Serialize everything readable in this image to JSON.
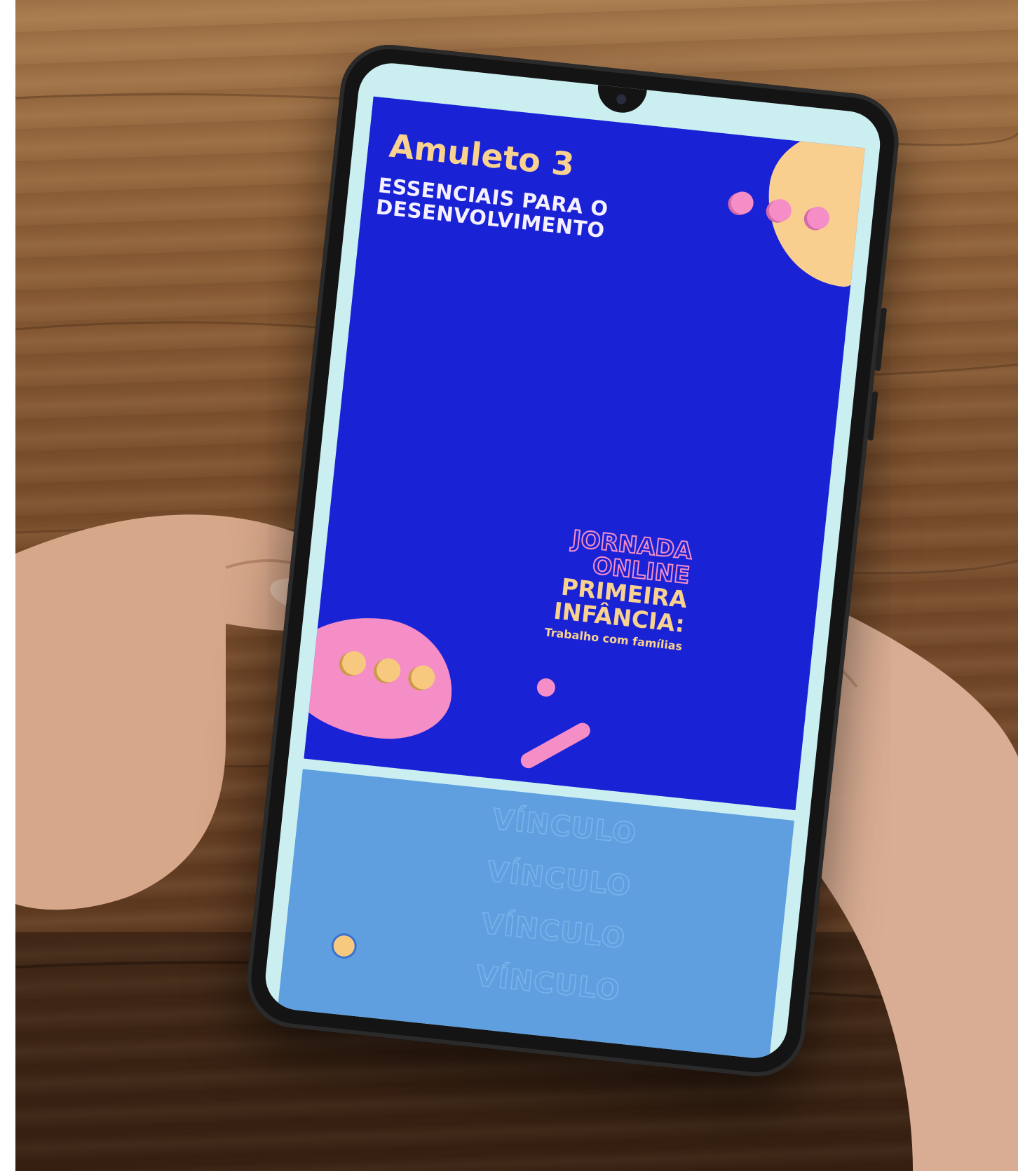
{
  "story": {
    "title": "Amuleto 3",
    "subtitle": "ESSENCIAIS PARA O DESENVOLVIMENTO",
    "jornada_line1": "JORNADA",
    "jornada_line2": "ONLINE",
    "primeira_line1": "PRIMEIRA",
    "primeira_line2": "INFÂNCIA:",
    "tagline": "Trabalho com famílias"
  },
  "next_story": {
    "repeated_word": "VÍNCULO"
  },
  "colors": {
    "story_background": "#1a22d6",
    "accent_yellow": "#f9d28f",
    "accent_pink": "#f58ec6",
    "next_story_background": "#5f9fe0"
  }
}
